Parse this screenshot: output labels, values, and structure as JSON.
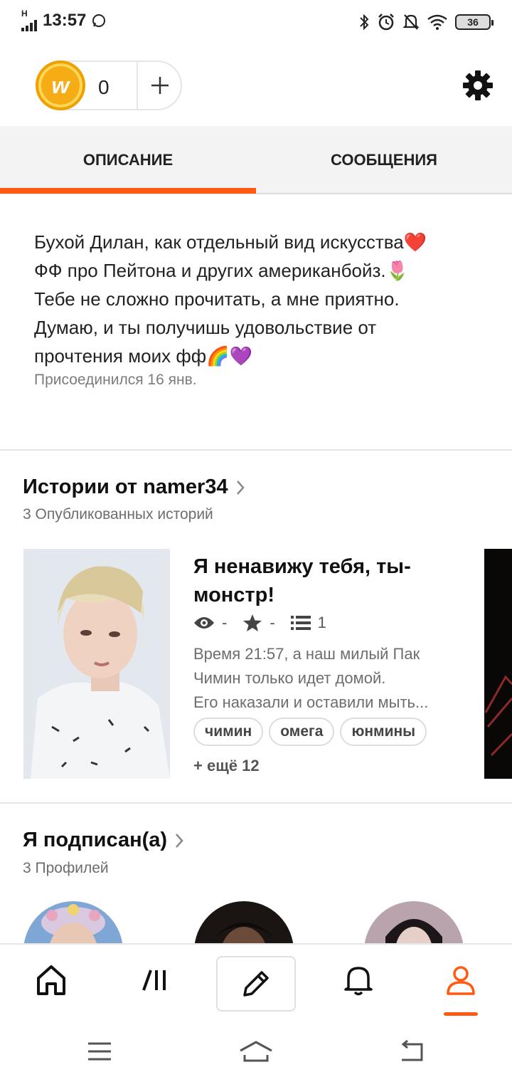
{
  "status_bar": {
    "network": "H",
    "time": "13:57",
    "battery": "36"
  },
  "header": {
    "coins": "0"
  },
  "tabs": [
    {
      "label": "ОПИСАНИЕ",
      "active": true
    },
    {
      "label": "СООБЩЕНИЯ",
      "active": false
    }
  ],
  "profile": {
    "description_lines": [
      "Бухой Дилан, как отдельный вид искусства❤️",
      "ФФ про Пейтона и других американбойз.🌷",
      "Тебе не сложно прочитать, а мне приятно.",
      "Думаю, и ты получишь удовольствие от",
      "прочтения моих фф🌈💜"
    ],
    "joined": "Присоединился 16 янв."
  },
  "stories_section": {
    "title": "Истории от namer34",
    "subtitle": "3 Опубликованных историй",
    "story": {
      "title": "Я ненавижу тебя, ты-монстр!",
      "reads": "-",
      "votes": "-",
      "parts": "1",
      "description_lines": [
        "Время 21:57, а наш милый Пак",
        "Чимин только идет домой.",
        "Его наказали и оставили мыть..."
      ],
      "tags": [
        "чимин",
        "омега",
        "юнмины"
      ],
      "more_tags": "+ ещё 12"
    }
  },
  "following_section": {
    "title": "Я подписан(а)",
    "subtitle": "3 Профилей"
  },
  "colors": {
    "accent": "#ff5a11",
    "coin": "#f6ac14"
  },
  "icons": {
    "nav": [
      "home-icon",
      "library-icon",
      "pencil-icon",
      "bell-icon",
      "profile-icon"
    ],
    "system": [
      "menu-icon",
      "home-icon",
      "back-icon"
    ]
  }
}
